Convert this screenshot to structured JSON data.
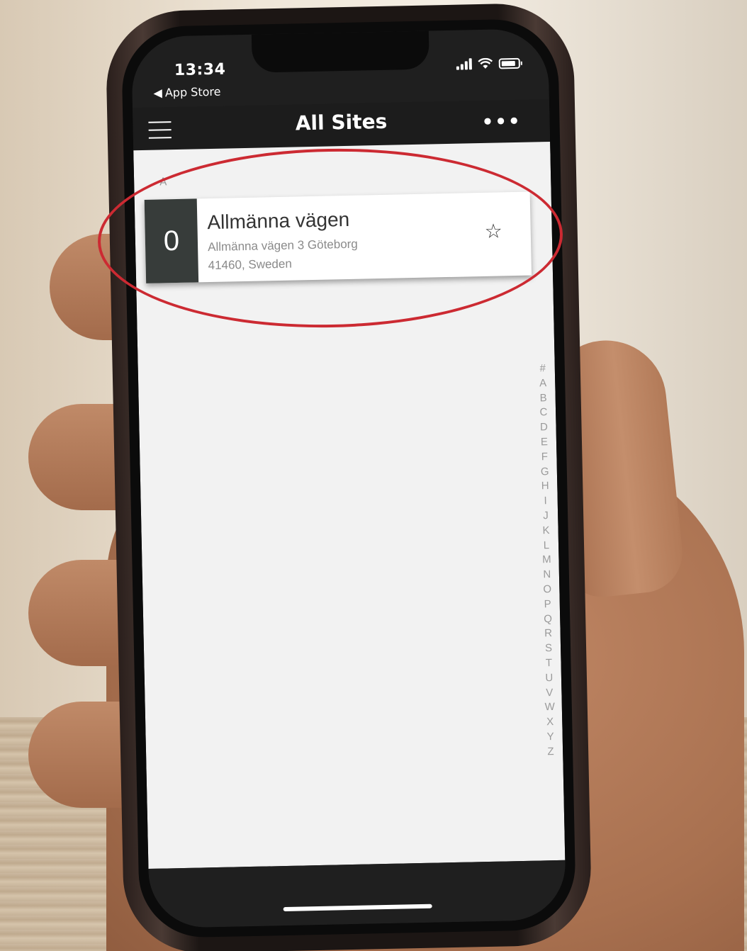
{
  "status_bar": {
    "time": "13:34",
    "back_label": "App Store",
    "back_icon": "back-triangle-icon"
  },
  "app_bar": {
    "title": "All Sites",
    "menu_icon": "hamburger-menu-icon",
    "more_icon": "more-dots-icon"
  },
  "list": {
    "section_letter": "A",
    "sites": [
      {
        "count": "0",
        "name": "Allmänna vägen",
        "address_line1": "Allmänna vägen 3 Göteborg",
        "address_line2": "41460, Sweden",
        "favorite_icon": "star-outline-icon"
      }
    ]
  },
  "index_letters": [
    "#",
    "A",
    "B",
    "C",
    "D",
    "E",
    "F",
    "G",
    "H",
    "I",
    "J",
    "K",
    "L",
    "M",
    "N",
    "O",
    "P",
    "Q",
    "R",
    "S",
    "T",
    "U",
    "V",
    "W",
    "X",
    "Y",
    "Z"
  ],
  "colors": {
    "highlight": "#cc2a32",
    "count_badge": "#373c3a",
    "app_bar": "#1c1c1c"
  }
}
